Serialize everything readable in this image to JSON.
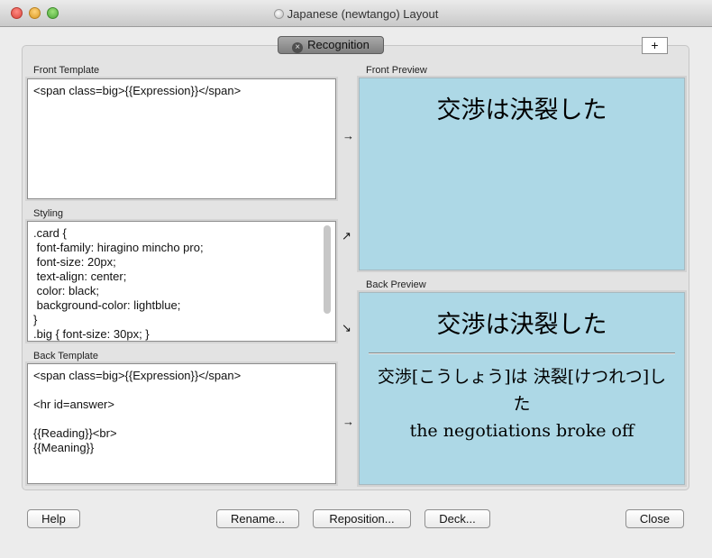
{
  "window": {
    "title": "Japanese (newtango) Layout"
  },
  "tabs": {
    "active_label": "Recognition",
    "add_label": "+"
  },
  "front_template": {
    "label": "Front Template",
    "value": "<span class=big>{{Expression}}</span>"
  },
  "styling": {
    "label": "Styling",
    "value": ".card {\n font-family: hiragino mincho pro;\n font-size: 20px;\n text-align: center;\n color: black;\n background-color: lightblue;\n}\n.big { font-size: 30px; }"
  },
  "back_template": {
    "label": "Back Template",
    "value": "<span class=big>{{Expression}}</span>\n\n<hr id=answer>\n\n{{Reading}}<br>\n{{Meaning}}"
  },
  "front_preview": {
    "label": "Front Preview",
    "expression": "交渉は決裂した"
  },
  "back_preview": {
    "label": "Back Preview",
    "expression": "交渉は決裂した",
    "reading_line1": "交渉[こうしょう]は 決裂[けつれつ]し",
    "reading_line2": "た",
    "meaning": "the negotiations broke off"
  },
  "arrows": {
    "front": "→",
    "styling_up": "↗",
    "styling_down": "↘",
    "back": "→"
  },
  "buttons": {
    "help": "Help",
    "rename": "Rename...",
    "reposition": "Reposition...",
    "deck": "Deck...",
    "close": "Close"
  },
  "colors": {
    "preview_background": "#add8e6"
  }
}
